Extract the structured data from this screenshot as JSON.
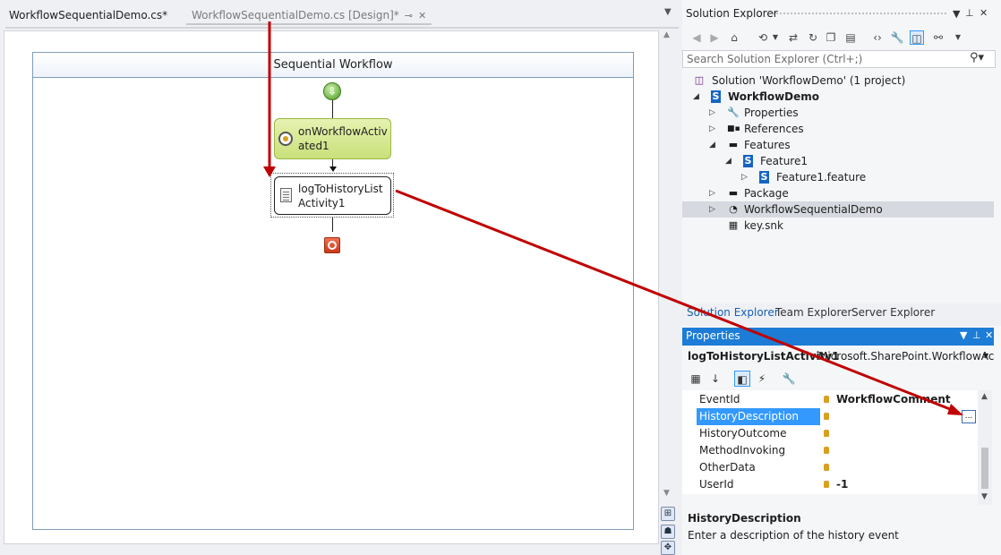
{
  "doc_tabs": {
    "tab1": "WorkflowSequentialDemo.cs*",
    "tab2": "WorkflowSequentialDemo.cs [Design]*",
    "pin_icon": "pin-icon",
    "close_icon": "close-icon"
  },
  "designer": {
    "header": "Sequential Workflow",
    "activity1": "onWorkflowActivated1",
    "activity2": "logToHistoryListActivity1"
  },
  "solution_explorer": {
    "title": "Solution Explorer",
    "search_placeholder": "Search Solution Explorer (Ctrl+;)",
    "tree": [
      {
        "label": "Solution 'WorkflowDemo' (1 project)"
      },
      {
        "label": "WorkflowDemo"
      },
      {
        "label": "Properties"
      },
      {
        "label": "References"
      },
      {
        "label": "Features"
      },
      {
        "label": "Feature1"
      },
      {
        "label": "Feature1.feature"
      },
      {
        "label": "Package"
      },
      {
        "label": "WorkflowSequentialDemo"
      },
      {
        "label": "key.snk"
      }
    ],
    "bottom_tabs": [
      "Solution Explorer",
      "Team Explorer",
      "Server Explorer"
    ]
  },
  "properties": {
    "title": "Properties",
    "object_name": "logToHistoryListActivity1",
    "object_type": "Microsoft.SharePoint.WorkflowAct",
    "rows": [
      {
        "name": "EventId",
        "value": "WorkflowComment"
      },
      {
        "name": "HistoryDescription",
        "value": ""
      },
      {
        "name": "HistoryOutcome",
        "value": ""
      },
      {
        "name": "MethodInvoking",
        "value": ""
      },
      {
        "name": "OtherData",
        "value": ""
      },
      {
        "name": "UserId",
        "value": "-1"
      }
    ],
    "ellipsis_label": "...",
    "description_name": "HistoryDescription",
    "description_text": "Enter a description of the history event"
  },
  "colors": {
    "accent": "#1c7cd6",
    "selection": "#3399ff",
    "annotation_arrow": "#c00000"
  }
}
